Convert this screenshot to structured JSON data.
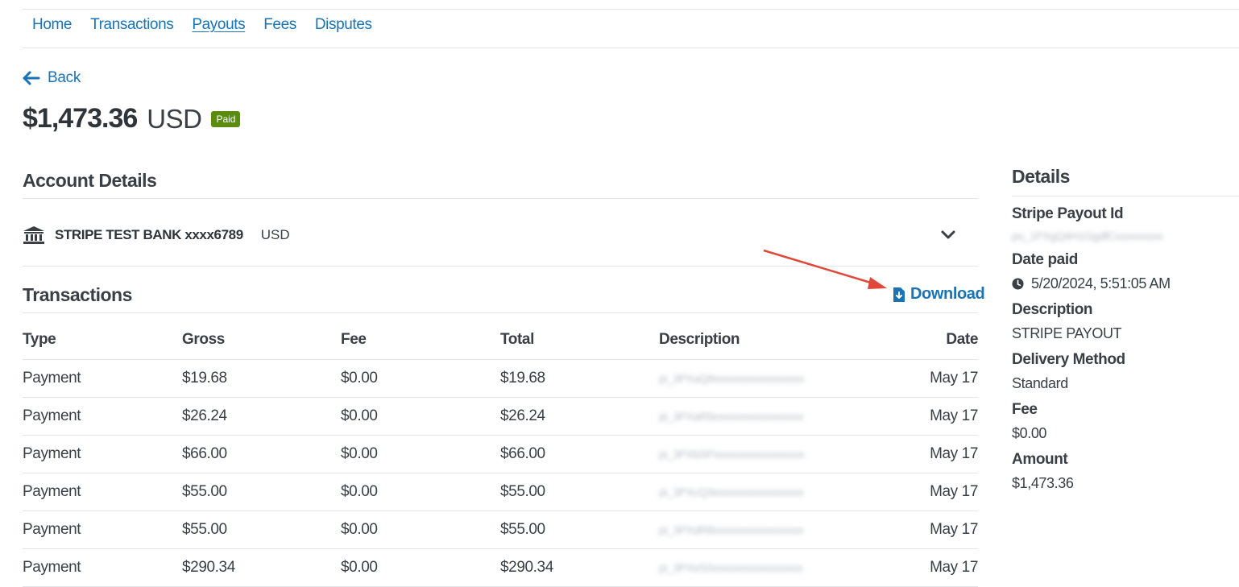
{
  "nav": {
    "items": [
      "Home",
      "Transactions",
      "Payouts",
      "Fees",
      "Disputes"
    ],
    "active": "Payouts"
  },
  "back_label": "Back",
  "payout": {
    "amount": "$1,473.36",
    "currency": "USD",
    "status": "Paid",
    "status_color": "#5b8c0f"
  },
  "account_details": {
    "title": "Account Details",
    "bank_name": "STRIPE TEST BANK xxxx6789",
    "bank_currency": "USD",
    "bank_icon": "bank-icon",
    "expand_icon": "chevron-down-icon"
  },
  "transactions": {
    "title": "Transactions",
    "download_label": "Download",
    "download_icon": "file-download-icon",
    "columns": [
      "Type",
      "Gross",
      "Fee",
      "Total",
      "Description",
      "Date"
    ],
    "rows": [
      {
        "type": "Payment",
        "gross": "$19.68",
        "fee": "$0.00",
        "total": "$19.68",
        "description": "pi_3PXaQ8xxxxxxxxxxxxxxxxx",
        "date": "May 17"
      },
      {
        "type": "Payment",
        "gross": "$26.24",
        "fee": "$0.00",
        "total": "$26.24",
        "description": "pi_3PXaR9xxxxxxxxxxxxxxxxx",
        "date": "May 17"
      },
      {
        "type": "Payment",
        "gross": "$66.00",
        "fee": "$0.00",
        "total": "$66.00",
        "description": "pi_3PXbSPxxxxxxxxxxxxxxxxx",
        "date": "May 17"
      },
      {
        "type": "Payment",
        "gross": "$55.00",
        "fee": "$0.00",
        "total": "$55.00",
        "description": "pi_3PXcQ3xxxxxxxxxxxxxxxxx",
        "date": "May 17"
      },
      {
        "type": "Payment",
        "gross": "$55.00",
        "fee": "$0.00",
        "total": "$55.00",
        "description": "pi_3PXdR8xxxxxxxxxxxxxxxxx",
        "date": "May 17"
      },
      {
        "type": "Payment",
        "gross": "$290.34",
        "fee": "$0.00",
        "total": "$290.34",
        "description": "pi_3PXeS0xxxxxxxxxxxxxxxxx",
        "date": "May 17"
      }
    ]
  },
  "details": {
    "title": "Details",
    "payout_id_label": "Stripe Payout Id",
    "payout_id": "po_1PXgQ4H1GgdfCxxxxxxxxx",
    "date_paid_label": "Date paid",
    "date_paid": "5/20/2024, 5:51:05 AM",
    "clock_icon": "clock-icon",
    "description_label": "Description",
    "description": "STRIPE PAYOUT",
    "delivery_label": "Delivery Method",
    "delivery": "Standard",
    "fee_label": "Fee",
    "fee": "$0.00",
    "amount_label": "Amount",
    "amount": "$1,473.36"
  },
  "colors": {
    "link": "#1a73b5",
    "annotation_arrow": "#e0483a"
  }
}
